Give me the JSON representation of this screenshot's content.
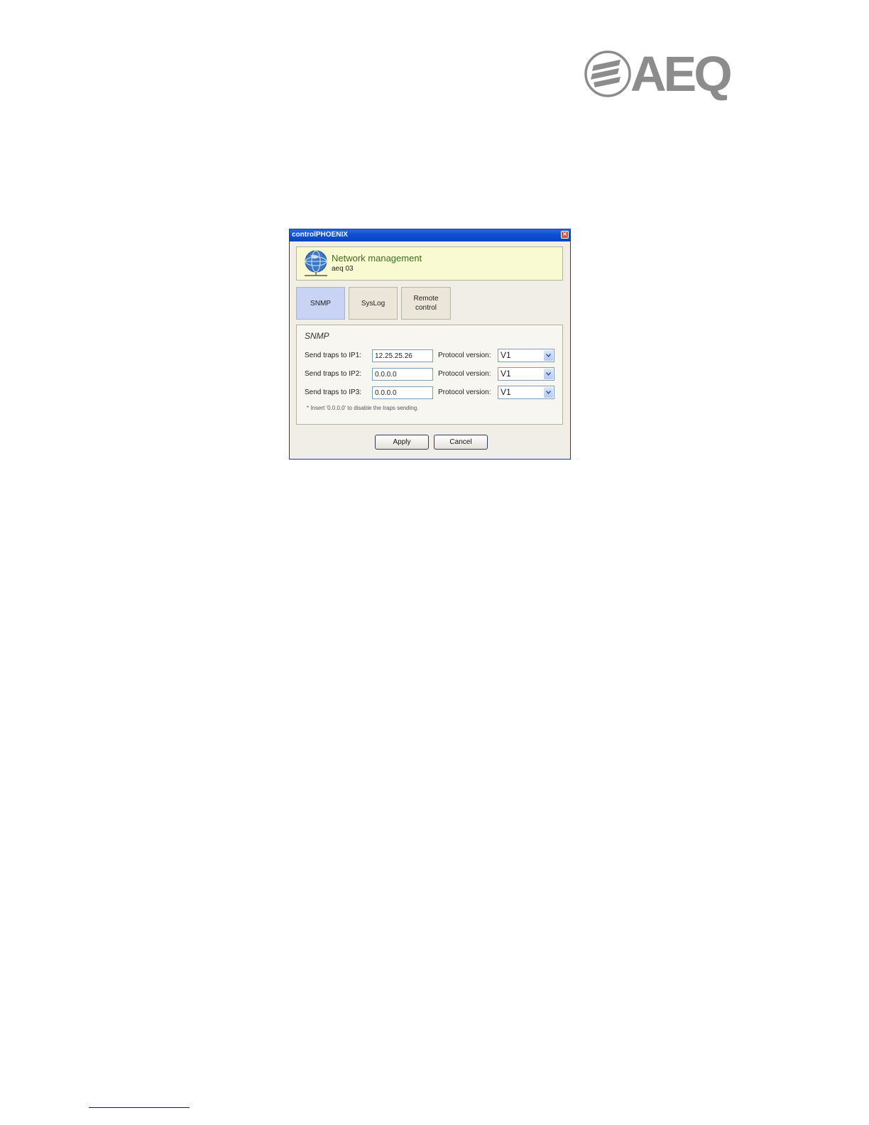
{
  "logo": {
    "text": "AEQ",
    "color": "#8c8c8c"
  },
  "window": {
    "title": "controlPHOENIX",
    "close_icon": "close-icon"
  },
  "header": {
    "icon": "network-globe-icon",
    "title": "Network management",
    "subtitle": "aeq 03"
  },
  "tabs": [
    {
      "label": "SNMP",
      "active": true
    },
    {
      "label": "SysLog",
      "active": false
    },
    {
      "label": "Remote\ncontrol",
      "active": false
    }
  ],
  "snmp": {
    "section_title": "SNMP",
    "rows": [
      {
        "label": "Send traps to IP1:",
        "ip": "12.25.25.26",
        "protocol_label": "Protocol version:",
        "protocol_value": "V1"
      },
      {
        "label": "Send traps to IP2:",
        "ip": "0.0.0.0",
        "protocol_label": "Protocol version:",
        "protocol_value": "V1"
      },
      {
        "label": "Send traps to IP3:",
        "ip": "0.0.0.0",
        "protocol_label": "Protocol version:",
        "protocol_value": "V1"
      }
    ],
    "note": "* Insert '0.0.0.0' to disable the traps sending."
  },
  "buttons": {
    "apply": "Apply",
    "cancel": "Cancel"
  },
  "colors": {
    "titlebar": "#0c4ed0",
    "header_bg": "#fafad2",
    "active_tab": "#c9d3f3",
    "header_title": "#3d6b1f"
  }
}
